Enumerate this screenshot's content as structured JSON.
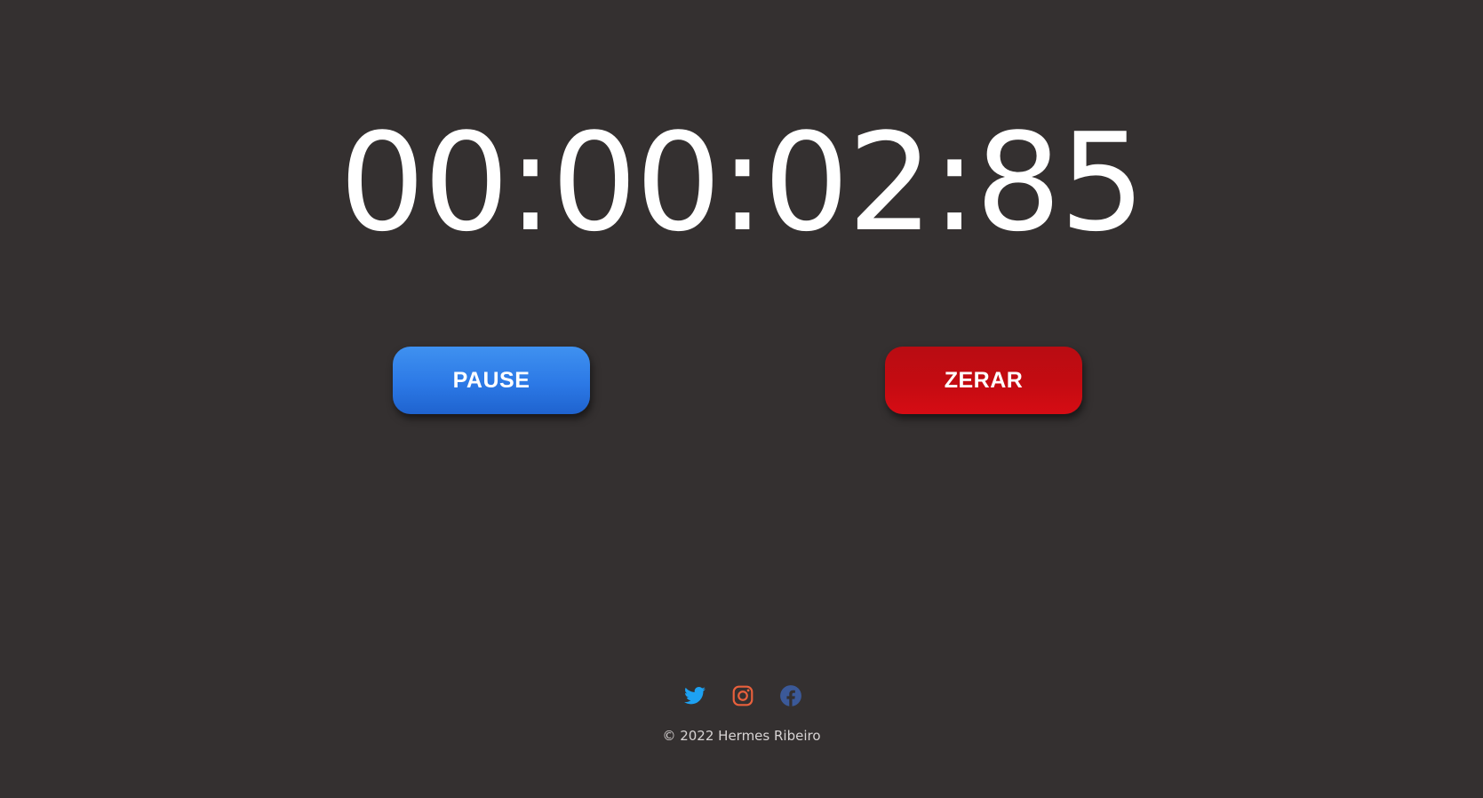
{
  "timer": {
    "display": "00:00:02:85"
  },
  "buttons": {
    "pause_label": "PAUSE",
    "reset_label": "ZERAR"
  },
  "social": [
    {
      "icon": "twitter-icon",
      "color": "#1da1f2"
    },
    {
      "icon": "instagram-icon",
      "color": "#e8603c"
    },
    {
      "icon": "facebook-icon",
      "color": "#3b5998"
    }
  ],
  "footer": {
    "copyright": "© 2022 Hermes Ribeiro"
  },
  "colors": {
    "background": "#343030",
    "pause_button": "#2c79e6",
    "reset_button": "#c40b11",
    "text": "#ffffff"
  }
}
